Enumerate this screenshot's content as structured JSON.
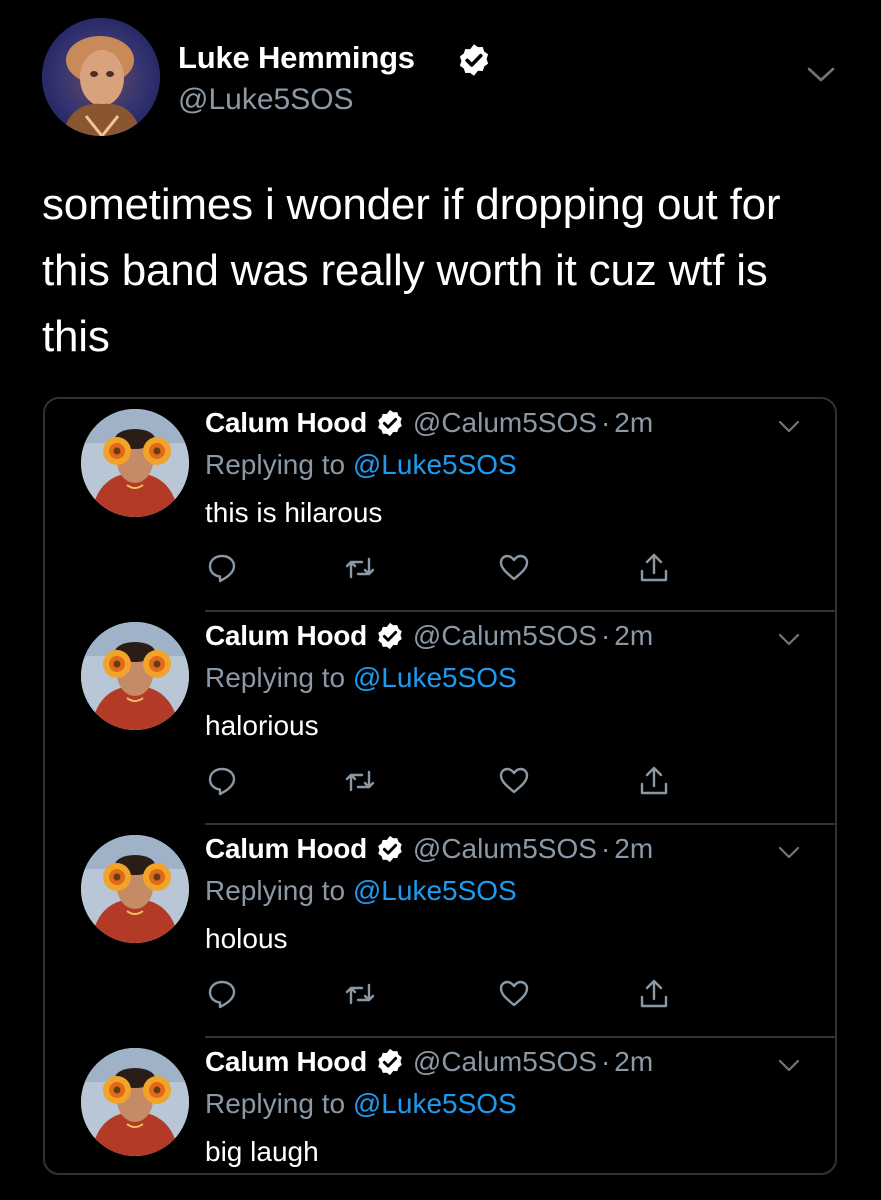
{
  "tweet": {
    "author_name": "Luke Hemmings",
    "author_handle": "@Luke5SOS",
    "verified": true,
    "text": "sometimes i wonder if dropping out for this band was really worth it cuz wtf is this",
    "avatar_icon": "avatar-photo-luke",
    "menu_icon": "chevron-down-icon"
  },
  "replies": [
    {
      "name": "Calum Hood",
      "handle": "@Calum5SOS",
      "separator": "·",
      "time": "2m",
      "replying_prefix": "Replying to",
      "replying_to": "@Luke5SOS",
      "text": "this is hilarous"
    },
    {
      "name": "Calum Hood",
      "handle": "@Calum5SOS",
      "separator": "·",
      "time": "2m",
      "replying_prefix": "Replying to",
      "replying_to": "@Luke5SOS",
      "text": "halorious"
    },
    {
      "name": "Calum Hood",
      "handle": "@Calum5SOS",
      "separator": "·",
      "time": "2m",
      "replying_prefix": "Replying to",
      "replying_to": "@Luke5SOS",
      "text": "holous"
    },
    {
      "name": "Calum Hood",
      "handle": "@Calum5SOS",
      "separator": "·",
      "time": "2m",
      "replying_prefix": "Replying to",
      "replying_to": "@Luke5SOS",
      "text": "big laugh"
    }
  ],
  "action_icons": [
    "reply-icon",
    "retweet-icon",
    "like-icon",
    "share-icon"
  ],
  "colors": {
    "background": "#000000",
    "text": "#ffffff",
    "secondary_text": "#8b98a5",
    "link": "#1d9bf0",
    "border": "#2f3336"
  }
}
